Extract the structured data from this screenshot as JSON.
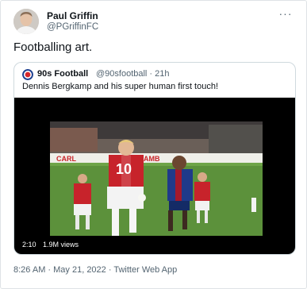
{
  "tweet": {
    "author_name": "Paul Griffin",
    "author_handle": "@PGriffinFC",
    "text": "Footballing art.",
    "timestamp": "8:26 AM · May 21, 2022 · Twitter Web App",
    "more_icon": "more-horizontal-icon"
  },
  "quoted": {
    "author_name": "90s Football",
    "author_handle": "@90sfootball",
    "age": "21h",
    "meta": "@90sfootball · 21h",
    "text": "Dennis Bergkamp and his super human first touch!"
  },
  "video": {
    "duration": "2:10",
    "views": "1.9M views",
    "frame_text": {
      "player_number": "10",
      "board_left": "CARL",
      "board_right": "AMB"
    }
  }
}
